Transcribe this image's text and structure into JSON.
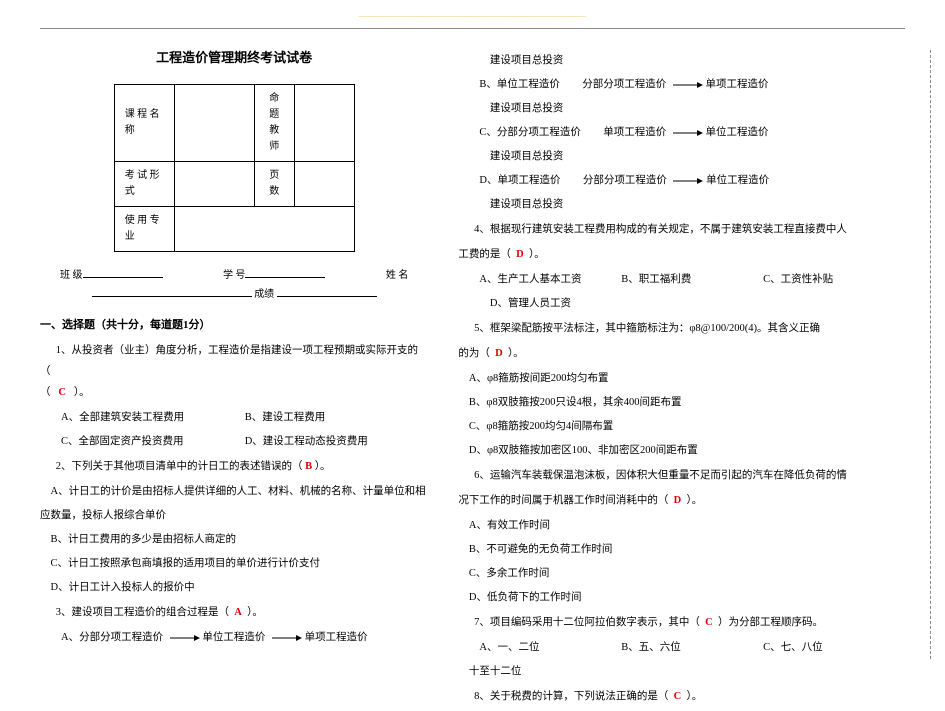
{
  "watermark": "――――――――――――――――――――――――",
  "doc": {
    "title": "工程造价管理期终考试试卷",
    "table": {
      "r1c1": "课 程\n名称",
      "r1c2": "",
      "r1c3": "命题\n教师",
      "r1c4": "",
      "r2c1": "考 试\n形式",
      "r2c2": "",
      "r2c3": "页\n\n数",
      "r2c4": "",
      "r3c1": "使 用\n专业",
      "r3c2": ""
    },
    "meta": {
      "class": "班 级",
      "number": "学 号",
      "name": "姓 名",
      "score": "成绩"
    },
    "s1": {
      "heading": "一、选择题（共十分，每道题1分）",
      "q1": "1、从投资者（业主）角度分析，工程造价是指建设一项工程预期或实际开支的（",
      "q1b": "）。",
      "q1pA": "全部建筑安装工程费用",
      "q1pB": "建设工程费用",
      "q1pC": "全部固定资产投资费用",
      "q1pD": "建设工程动态投资费用",
      "q2": "2、下列关于其他项目清单中的计日工的表述错误的（",
      "q2b": "）。",
      "q2a": "计日工的计价是由招标人提供详细的人工、材料、机械的名称、计量单位和相",
      "q2a2": "应数量，投标人报综合单价",
      "q2bb": "计日工费用的多少是由招标人商定的",
      "q2c": "计日工按照承包商填报的适用项目的单价进行计价支付",
      "q2d": "计日工计入投标人的报价中",
      "q3": "3、建设项目工程造价的组合过程是（",
      "q3b": "）。",
      "flowA1": "分部分项工程造价",
      "flowA2": "单位工程造价",
      "flowA3": "单项工程造价",
      "flowAend": "建设项目总投资",
      "flowB0": "单位工程造价",
      "flowB1": "分部分项工程造价",
      "flowB2": "单项工程造价",
      "flowBend": "建设项目总投资",
      "flowC0": "分部分项工程造价",
      "flowC1": "单项工程造价",
      "flowC2": "单位工程造价",
      "flowCend": "建设项目总投资",
      "flowD0": "单项工程造价",
      "flowD1": "分部分项工程造价",
      "flowD2": "单位工程造价",
      "flowDend": "建设项目总投资"
    },
    "s2": {
      "q4": "4、根据现行建筑安装工程费用构成的有关规定，不属于建筑安装工程直接费中人",
      "q4b": "工费的是（",
      "q4c": "）。",
      "q4a": "生产工人基本工资",
      "q4bb": "职工福利费",
      "q4cc": "工资性补贴",
      "q4d": "管理人员工资",
      "q5": "5、框架梁配筋按平法标注，其中箍筋标注为：φ8@100/200(4)。其含义正确",
      "q5b": "的为（",
      "q5c": "）。",
      "q5a": "φ8箍筋按间距200均匀布置",
      "q5bb": "φ8双肢箍按200只设4根，其余400间距布置",
      "q5cc": "φ8箍筋按200均匀4间隔布置",
      "q5d": "φ8双肢箍按加密区100、非加密区200间距布置",
      "q6": "6、运输汽车装载保温泡沫板，因体积大但重量不足而引起的汽车在降低负荷的情",
      "q6b": "况下工作的时间属于机器工作时间消耗中的（",
      "q6c": "）。",
      "q6a": "有效工作时间",
      "q6bb": "不可避免的无负荷工作时间",
      "q6cc": "多余工作时间",
      "q6d": "低负荷下的工作时间",
      "q7": "7、项目编码采用十二位阿拉伯数字表示，其中（",
      "q7b": "）为分部工程顺序码。",
      "q7a": "一、二位",
      "q7bb": "五、六位",
      "q7c": "七、八位",
      "q7d": "十至十二位",
      "q8": "8、关于税费的计算，下列说法正确的是（",
      "q8b": "）。"
    }
  }
}
